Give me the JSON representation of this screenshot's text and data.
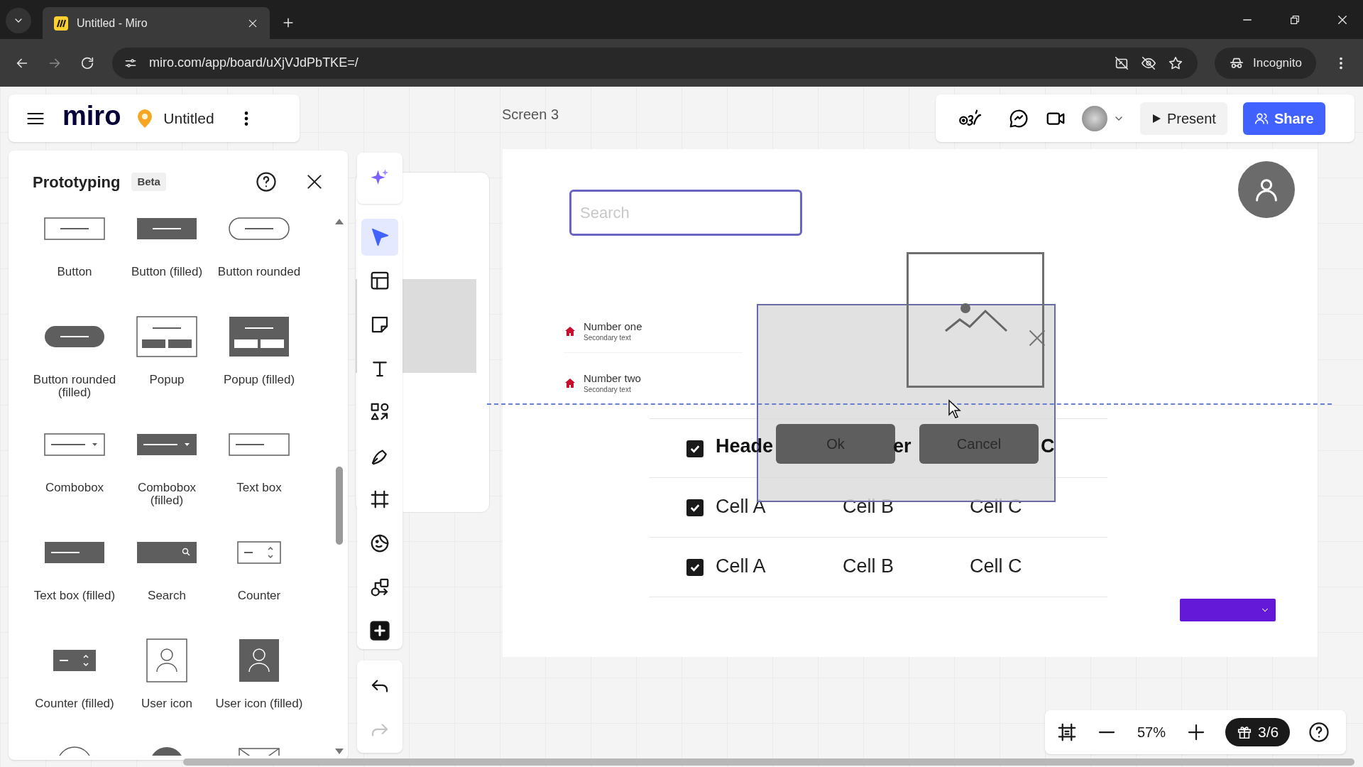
{
  "browser": {
    "tabs": [
      {
        "title": "Untitled - Miro",
        "selected": true
      }
    ],
    "url": "miro.com/app/board/uXjVJdPbTKE=/",
    "profile_label": "Incognito"
  },
  "board": {
    "logo": "miro",
    "name": "Untitled",
    "frame_title": "Screen 3"
  },
  "header_buttons": [
    {
      "kind": "present",
      "label": "Present"
    },
    {
      "kind": "share",
      "label": "Share"
    }
  ],
  "panel": {
    "title": "Prototyping",
    "badge": "Beta",
    "items": [
      {
        "kind": "button",
        "label": "Button"
      },
      {
        "kind": "button_filled",
        "label": "Button (filled)"
      },
      {
        "kind": "button_rounded",
        "label": "Button rounded"
      },
      {
        "kind": "button_rounded_filled",
        "label": "Button rounded (filled)"
      },
      {
        "kind": "popup",
        "label": "Popup"
      },
      {
        "kind": "popup_filled",
        "label": "Popup (filled)"
      },
      {
        "kind": "combobox",
        "label": "Combobox"
      },
      {
        "kind": "combobox_filled",
        "label": "Combobox (filled)"
      },
      {
        "kind": "textbox",
        "label": "Text box"
      },
      {
        "kind": "textbox_filled",
        "label": "Text box (filled)"
      },
      {
        "kind": "search",
        "label": "Search"
      },
      {
        "kind": "counter",
        "label": "Counter"
      },
      {
        "kind": "counter_filled",
        "label": "Counter (filled)"
      },
      {
        "kind": "user_icon",
        "label": "User icon"
      },
      {
        "kind": "user_icon_filled",
        "label": "User icon (filled)"
      },
      {
        "kind": "circle"
      },
      {
        "kind": "circle_filled"
      },
      {
        "kind": "image"
      }
    ]
  },
  "tools": [
    {
      "kind": "ai",
      "selected": false
    },
    {
      "kind": "select",
      "selected": true
    },
    {
      "kind": "templates",
      "selected": false
    },
    {
      "kind": "sticky",
      "selected": false
    },
    {
      "kind": "text",
      "selected": false
    },
    {
      "kind": "shapes",
      "selected": false
    },
    {
      "kind": "pen",
      "selected": false
    },
    {
      "kind": "frame",
      "selected": false
    },
    {
      "kind": "sticker",
      "selected": false
    },
    {
      "kind": "diagram",
      "selected": false
    },
    {
      "kind": "more",
      "selected": false
    }
  ],
  "history": [
    {
      "kind": "undo",
      "disabled": false
    },
    {
      "kind": "redo",
      "disabled": true
    }
  ],
  "frame": {
    "search": {
      "placeholder": "Search"
    },
    "list": [
      {
        "title": "Number one",
        "subtitle": "Secondary text"
      },
      {
        "title": "Number two",
        "subtitle": "Secondary text"
      }
    ],
    "popup": {
      "buttons": [
        "Ok",
        "Cancel"
      ]
    },
    "table": {
      "header": {
        "checked": true,
        "cells": [
          "Heade",
          "er",
          "C"
        ]
      },
      "rows": [
        {
          "checked": true,
          "cells": [
            "Cell A",
            "Cell B",
            "Cell C"
          ]
        },
        {
          "checked": true,
          "cells": [
            "Cell A",
            "Cell B",
            "Cell C"
          ]
        }
      ]
    }
  },
  "zoom": {
    "level_text": "57%",
    "counter": "3/6"
  }
}
